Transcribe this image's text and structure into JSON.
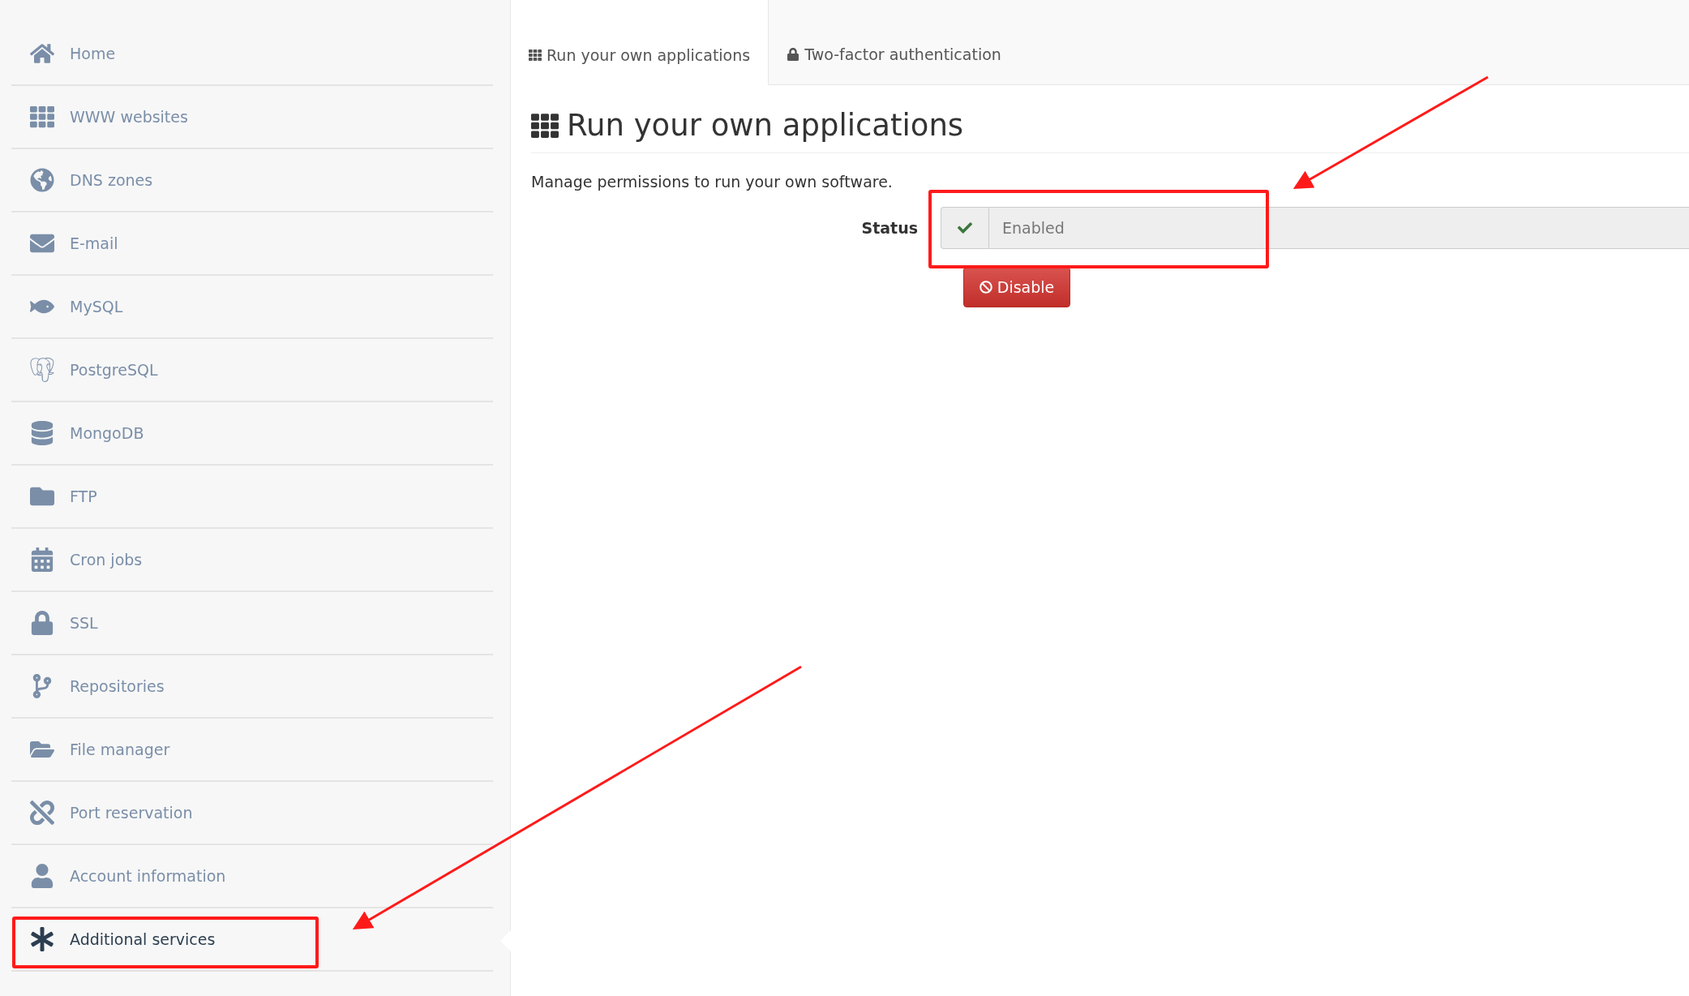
{
  "sidebar": {
    "items": [
      {
        "label": "Home",
        "selected": false
      },
      {
        "label": "WWW websites",
        "selected": false
      },
      {
        "label": "DNS zones",
        "selected": false
      },
      {
        "label": "E-mail",
        "selected": false
      },
      {
        "label": "MySQL",
        "selected": false
      },
      {
        "label": "PostgreSQL",
        "selected": false
      },
      {
        "label": "MongoDB",
        "selected": false
      },
      {
        "label": "FTP",
        "selected": false
      },
      {
        "label": "Cron jobs",
        "selected": false
      },
      {
        "label": "SSL",
        "selected": false
      },
      {
        "label": "Repositories",
        "selected": false
      },
      {
        "label": "File manager",
        "selected": false
      },
      {
        "label": "Port reservation",
        "selected": false
      },
      {
        "label": "Account information",
        "selected": false
      },
      {
        "label": "Additional services",
        "selected": true
      }
    ]
  },
  "tabs": [
    {
      "label": "Run your own applications",
      "selected": true
    },
    {
      "label": "Two-factor authentication",
      "selected": false
    }
  ],
  "heading": "Run your own applications",
  "description": "Manage permissions to run your own software.",
  "status": {
    "label": "Status",
    "value": "Enabled",
    "enabled": true
  },
  "disable_button": "Disable"
}
